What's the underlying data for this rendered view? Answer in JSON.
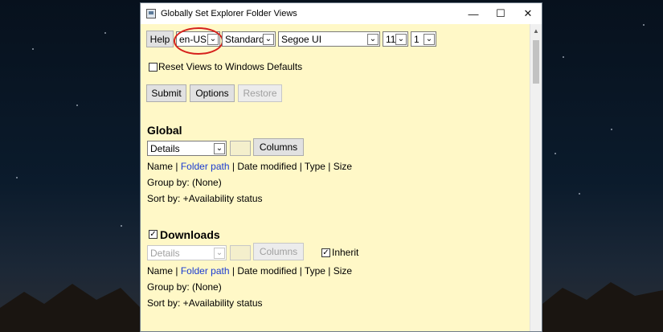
{
  "window": {
    "title": "Globally Set Explorer Folder Views"
  },
  "toolbar": {
    "help_label": "Help",
    "language": "en-US",
    "mode": "Standard",
    "font": "Segoe UI",
    "font_size": "11",
    "number": "1"
  },
  "reset_checkbox": {
    "label": "Reset Views to Windows Defaults",
    "checked": false
  },
  "actions": {
    "submit": "Submit",
    "options": "Options",
    "restore": "Restore"
  },
  "global": {
    "heading": "Global",
    "view": "Details",
    "columns_label": "Columns",
    "columns_line": {
      "name": "Name",
      "sep1": "|",
      "folder_path": "Folder path",
      "rest": "| Date modified | Type | Size"
    },
    "group_by": "Group by: (None)",
    "sort_by": "Sort by: +Availability status"
  },
  "downloads": {
    "heading": "Downloads",
    "checked": true,
    "view": "Details",
    "columns_label": "Columns",
    "inherit_label": "Inherit",
    "inherit_checked": true,
    "columns_line": {
      "name": "Name",
      "sep1": "|",
      "folder_path": "Folder path",
      "rest": "| Date modified | Type | Size"
    },
    "group_by": "Group by: (None)",
    "sort_by": "Sort by: +Availability status"
  },
  "icons": {
    "minimize": "minimize-icon",
    "maximize": "maximize-icon",
    "close": "close-icon",
    "check": "checkmark-icon",
    "dropdown": "chevron-down-icon"
  },
  "colors": {
    "client_bg": "#fff8c7",
    "link": "#1a3bd1",
    "highlight_oval": "#d6211c"
  }
}
